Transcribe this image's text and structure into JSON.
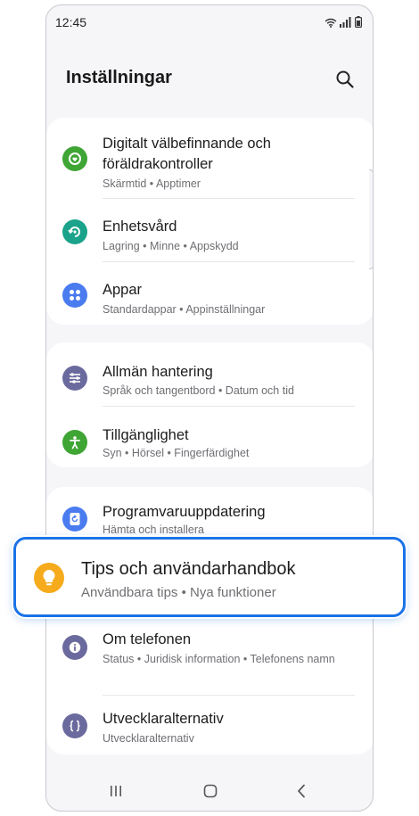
{
  "status_bar": {
    "time": "12:45"
  },
  "header": {
    "title": "Inställningar"
  },
  "colors": {
    "digital_wellbeing": "#3fa535",
    "device_care": "#1aa38a",
    "apps": "#4a7cf0",
    "general_management": "#6b6a9e",
    "accessibility": "#3fa535",
    "software_update": "#4a7cf0",
    "tips": "#f5ab1c",
    "about_phone": "#6b6a9e",
    "developer_options": "#6b6a9e",
    "highlight_border": "#1a73e8"
  },
  "groups": [
    {
      "items": [
        {
          "icon": "digital-wellbeing-icon",
          "title": "Digitalt välbefinnande och föräldrakontroller",
          "subtitle": "Skärmtid  •  Apptimer"
        },
        {
          "icon": "device-care-icon",
          "title": "Enhetsvård",
          "subtitle": "Lagring  •  Minne  •  Appskydd"
        },
        {
          "icon": "apps-icon",
          "title": "Appar",
          "subtitle": "Standardappar  •  Appinställningar"
        }
      ]
    },
    {
      "items": [
        {
          "icon": "general-management-icon",
          "title": "Allmän hantering",
          "subtitle": "Språk och tangentbord  •  Datum och tid"
        },
        {
          "icon": "accessibility-icon",
          "title": "Tillgänglighet",
          "subtitle": "Syn  •  Hörsel  •  Fingerfärdighet"
        }
      ]
    },
    {
      "items": [
        {
          "icon": "software-update-icon",
          "title": "Programvaruuppdatering",
          "subtitle": "Hämta och installera"
        },
        {
          "icon": "tips-icon",
          "title": "Tips och användarhandbok",
          "subtitle": "Användbara tips  •  Nya funktioner"
        },
        {
          "icon": "info-icon",
          "title": "Om telefonen",
          "subtitle": "Status  •  Juridisk information  •  Telefonens namn"
        },
        {
          "icon": "developer-options-icon",
          "title": "Utvecklaralternativ",
          "subtitle": "Utvecklaralternativ"
        }
      ]
    }
  ],
  "nav_bar": {
    "buttons": [
      "recents-icon",
      "home-icon",
      "back-icon"
    ]
  }
}
